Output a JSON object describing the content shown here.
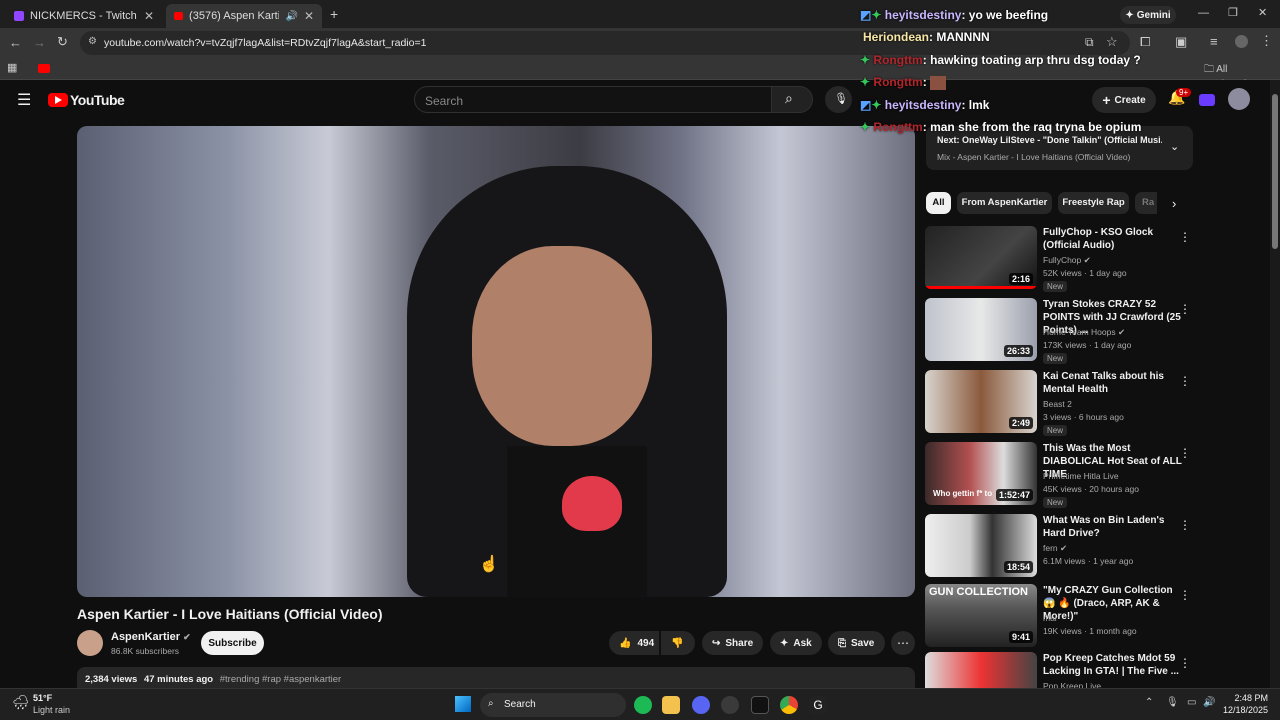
{
  "tabs": [
    {
      "label": "NICKMERCS - Twitch"
    },
    {
      "label": "(3576) Aspen Kartier - I Love"
    }
  ],
  "toolbar": {
    "url": "youtube.com/watch?v=tvZqjf7lagA&list=RDtvZqjf7lagA&start_radio=1",
    "gemini": "Gemini",
    "all_bookmarks": "All Bookmarks"
  },
  "header": {
    "logo": "YouTube",
    "search_placeholder": "Search",
    "create": "Create",
    "notif_badge": "9+"
  },
  "video": {
    "title": "Aspen Kartier - I Love Haitians (Official Video)",
    "channel": "AspenKartier",
    "subscribers": "86.8K subscribers",
    "subscribe": "Subscribe",
    "likes": "494",
    "share": "Share",
    "ask": "Ask",
    "save": "Save",
    "views": "2,384 views",
    "age": "47 minutes ago",
    "tags": "#trending #rap #aspenkartier"
  },
  "queue": {
    "next": "Next: OneWay LilSteve - \"Done Talkin\" (Official Musi...",
    "mix": "Mix - Aspen Kartier - I Love Haitians (Official Video)"
  },
  "chips": [
    "All",
    "From AspenKartier",
    "Freestyle Rap",
    "Ra"
  ],
  "recs": [
    {
      "title": "FullyChop - KSO Glock (Official Audio)",
      "channel": "FullyChop",
      "meta": "52K views · 1 day ago",
      "duration": "2:16",
      "badge": "New"
    },
    {
      "title": "Tyran Stokes CRAZY 52 POINTS with JJ Crawford (25 Points) ...",
      "channel": "Home Team Hoops",
      "meta": "173K views · 1 day ago",
      "duration": "26:33",
      "badge": "New"
    },
    {
      "title": "Kai Cenat Talks about his Mental Health",
      "channel": "Beast 2",
      "meta": "3 views · 6 hours ago",
      "duration": "2:49",
      "badge": "New"
    },
    {
      "title": "This Was the Most DIABOLICAL Hot Seat of ALL TIME",
      "channel": "Primetime Hitla Live",
      "meta": "45K views · 20 hours ago",
      "duration": "1:52:47",
      "badge": "New"
    },
    {
      "title": "What Was on Bin Laden's Hard Drive?",
      "channel": "fern",
      "meta": "6.1M views · 1 year ago",
      "duration": "18:54",
      "badge": ""
    },
    {
      "title": "\"My CRAZY Gun Collection 😱 🔥 (Draco, ARP, AK & More!)\"",
      "channel": "mar",
      "meta": "19K views · 1 month ago",
      "duration": "9:41",
      "badge": ""
    },
    {
      "title": "Pop Kreep Catches Mdot 59 Lacking In GTA! | The Five ...",
      "channel": "Pop Kreep Live",
      "meta": "",
      "duration": "",
      "badge": ""
    }
  ],
  "chat": [
    {
      "user": "heyitsdestiny",
      "msg": ": yo we beefing"
    },
    {
      "user": "Heriondean",
      "msg": ": MANNNN"
    },
    {
      "user": "Rongttm",
      "msg": ": hawking toating arp thru dsg today ?"
    },
    {
      "user": "Rongttm",
      "msg": ":"
    },
    {
      "user": "heyitsdestiny",
      "msg": ": lmk"
    },
    {
      "user": "Rongttm",
      "msg": ": man she from the raq tryna be opium"
    }
  ],
  "thumbnail_text": {
    "gun": "GUN COLLECTION",
    "hotseat": "Who gettin f* to"
  },
  "taskbar": {
    "temp": "51°F",
    "weather": "Light rain",
    "search": "Search",
    "time": "2:48 PM",
    "date": "12/18/2025"
  },
  "colors": {
    "accent": "#ff0000",
    "chat_green": "#34c759",
    "chat_user_blue": "#c9b6ff",
    "chat_red": "#b3262c"
  }
}
